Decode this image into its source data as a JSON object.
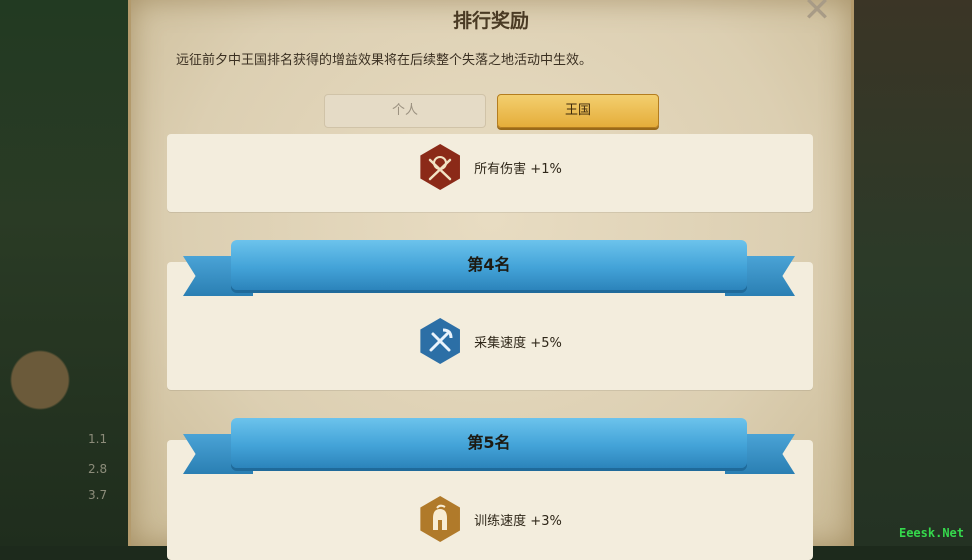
{
  "dialog": {
    "title": "排行奖励",
    "description": "远征前夕中王国排名获得的增益效果将在后续整个失落之地活动中生效。"
  },
  "tabs": [
    {
      "label": "个人",
      "active": false
    },
    {
      "label": "王国",
      "active": true
    }
  ],
  "rewards": [
    {
      "rank": "",
      "label": "所有伤害 +1%",
      "icon": "crossed-swords-icon",
      "icon_color": "#8b2a18"
    },
    {
      "rank": "第4名",
      "label": "采集速度 +5%",
      "icon": "pickaxe-shovel-icon",
      "icon_color": "#2c6fa6"
    },
    {
      "rank": "第5名",
      "label": "训练速度 +3%",
      "icon": "spartan-helmet-icon",
      "icon_color": "#b07a2a"
    }
  ],
  "background_text": [
    "1.1",
    "2.8",
    "3.7"
  ],
  "watermark": "Eeesk.Net"
}
